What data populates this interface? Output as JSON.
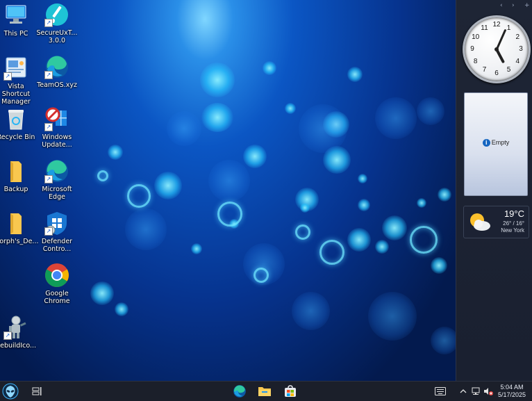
{
  "desktop": {
    "icons_col1": [
      {
        "label": "This PC",
        "icon": "computer-icon"
      },
      {
        "label": "Vista Shortcut Manager",
        "icon": "shortcut-manager-icon"
      },
      {
        "label": "Recycle Bin",
        "icon": "recycle-bin-icon"
      },
      {
        "label": "Backup",
        "icon": "folder-icon"
      },
      {
        "label": "Morph's_De...",
        "icon": "folder-icon"
      },
      {
        "label": "RebuildIco...",
        "icon": "robot-icon"
      }
    ],
    "icons_col2": [
      {
        "label": "SecureUxT... 3.0.0",
        "icon": "paintbrush-icon"
      },
      {
        "label": "TeamOS.xyz",
        "icon": "edge-icon"
      },
      {
        "label": "Windows Update...",
        "icon": "windows-update-blocker-icon"
      },
      {
        "label": "Microsoft Edge",
        "icon": "edge-icon"
      },
      {
        "label": "Defender Contro...",
        "icon": "defender-icon"
      },
      {
        "label": "Google Chrome",
        "icon": "chrome-icon"
      }
    ]
  },
  "sidebar": {
    "controls": [
      "‹",
      "›",
      "+"
    ],
    "clock": {
      "hour": 5,
      "minute": 4,
      "numbers": [
        "12",
        "1",
        "2",
        "3",
        "4",
        "5",
        "6",
        "7",
        "8",
        "9",
        "10",
        "11"
      ]
    },
    "notes": {
      "message": "Empty"
    },
    "weather": {
      "temperature": "19°C",
      "range": "26° / 16°",
      "location": "New York",
      "icon": "partly-cloudy-icon"
    }
  },
  "taskbar": {
    "start_icon": "alien-start-icon",
    "task_view_icon": "task-view-icon",
    "pinned": [
      {
        "name": "edge",
        "icon": "edge-icon"
      },
      {
        "name": "file-explorer",
        "icon": "folder-icon"
      },
      {
        "name": "store",
        "icon": "store-icon"
      }
    ],
    "tray": {
      "time": "5:04 AM",
      "date": "5/17/2025",
      "icons": [
        "keyboard-icon",
        "chevron-up-icon",
        "network-icon",
        "volume-muted-icon"
      ]
    }
  },
  "colors": {
    "taskbar": "#1b1f2a",
    "sidebar": "#1e2535",
    "accent": "#1565c0"
  }
}
